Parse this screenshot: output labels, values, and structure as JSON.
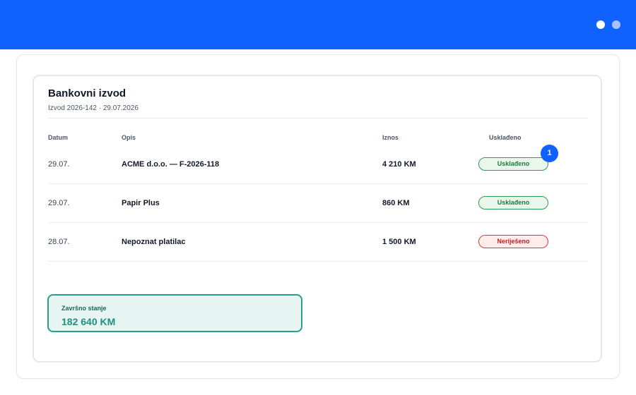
{
  "colors": {
    "brand": "#0f62fe",
    "reconciled": "#2e9d4f",
    "unresolved": "#d63b3b",
    "balance": "#2a9d8f"
  },
  "statement": {
    "title": "Bankovni izvod",
    "subtitle": "Izvod 2026-142 · 29.07.2026"
  },
  "table": {
    "headers": [
      "Datum",
      "Opis",
      "Iznos",
      "Usklađeno"
    ],
    "rows": [
      {
        "date": "29.07.",
        "description": "ACME d.o.o. — F-2026-118",
        "amount": "4 210 KM",
        "status": "Usklađeno",
        "status_type": "ok"
      },
      {
        "date": "29.07.",
        "description": "Papir Plus",
        "amount": "860 KM",
        "status": "Usklađeno",
        "status_type": "ok"
      },
      {
        "date": "28.07.",
        "description": "Nepoznat platilac",
        "amount": "1 500 KM",
        "status": "Neriješeno",
        "status_type": "bad"
      }
    ]
  },
  "notification": {
    "count": "1"
  },
  "balance": {
    "label": "Završno stanje",
    "value": "182 640 KM"
  }
}
